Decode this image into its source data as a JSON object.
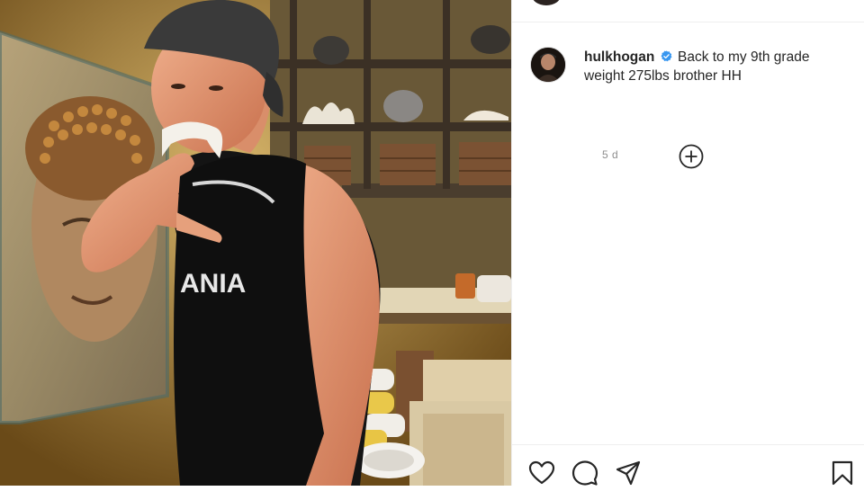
{
  "post": {
    "username": "hulkhogan",
    "verified": true,
    "caption": "Back to my 9th grade weight 275lbs brother HH",
    "time": "5 d"
  },
  "icons": {
    "verified": "verified-badge-icon",
    "load_more": "plus-circle-icon",
    "like": "heart-icon",
    "comment": "comment-icon",
    "share": "send-icon",
    "save": "bookmark-icon"
  },
  "colors": {
    "verified_blue": "#3897f0",
    "timestamp": "#8e8e8e",
    "divider": "#efefef"
  }
}
